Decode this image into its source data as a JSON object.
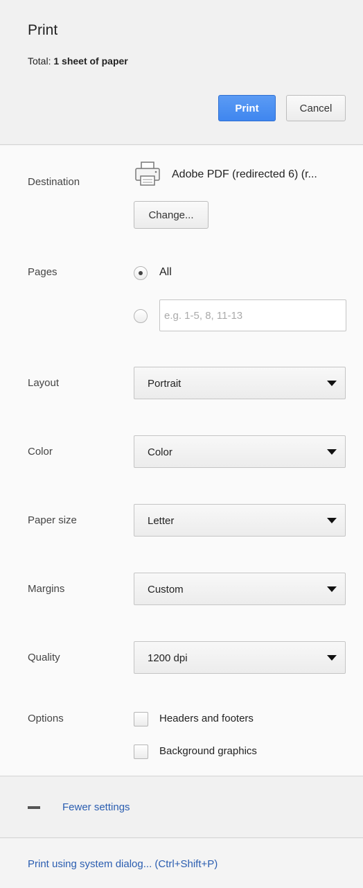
{
  "header": {
    "title": "Print",
    "summary_prefix": "Total: ",
    "summary_bold": "1 sheet of paper",
    "print_label": "Print",
    "cancel_label": "Cancel"
  },
  "destination": {
    "label": "Destination",
    "printer_name": "Adobe PDF (redirected 6) (r...",
    "change_label": "Change..."
  },
  "pages": {
    "label": "Pages",
    "all_label": "All",
    "all_selected": true,
    "custom_placeholder": "e.g. 1-5, 8, 11-13"
  },
  "layout": {
    "label": "Layout",
    "value": "Portrait"
  },
  "color": {
    "label": "Color",
    "value": "Color"
  },
  "paper_size": {
    "label": "Paper size",
    "value": "Letter"
  },
  "margins": {
    "label": "Margins",
    "value": "Custom"
  },
  "quality": {
    "label": "Quality",
    "value": "1200 dpi"
  },
  "options": {
    "label": "Options",
    "headers_footers_label": "Headers and footers",
    "headers_footers_checked": false,
    "background_graphics_label": "Background graphics",
    "background_graphics_checked": false
  },
  "fewer_settings": {
    "label": "Fewer settings",
    "icon": "minus-icon"
  },
  "footer": {
    "system_dialog_label": "Print using system dialog... (Ctrl+Shift+P)"
  },
  "colors": {
    "primary_button": "#4a8ff2",
    "link": "#2a5db0"
  }
}
